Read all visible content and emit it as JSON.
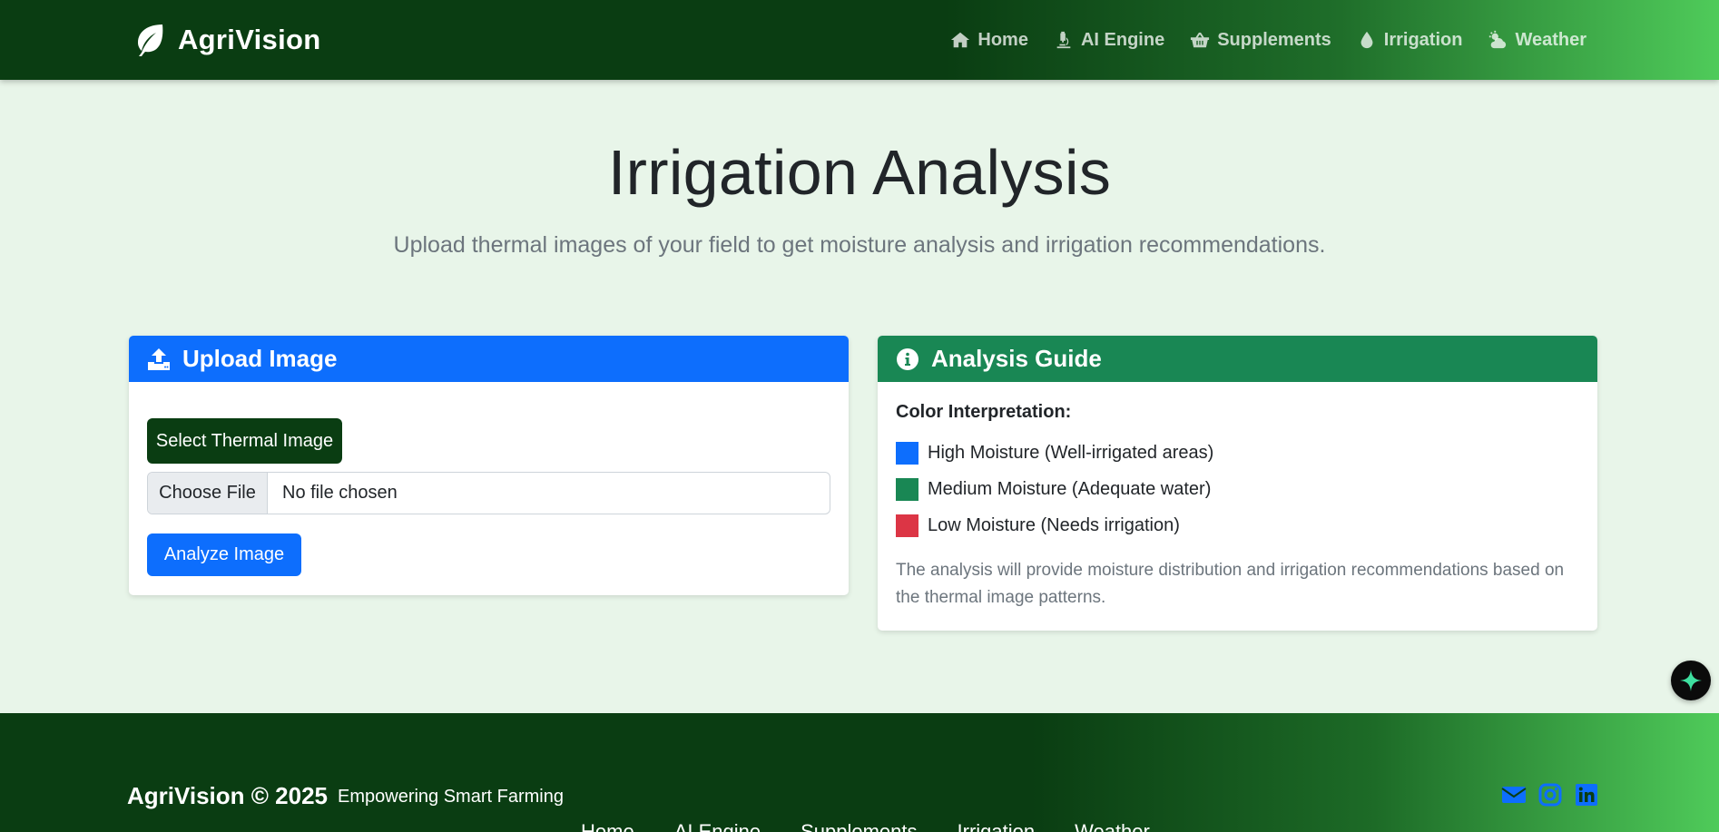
{
  "brand": {
    "name": "AgriVision"
  },
  "nav": {
    "items": [
      {
        "label": "Home",
        "icon": "home-icon"
      },
      {
        "label": "AI Engine",
        "icon": "microscope-icon"
      },
      {
        "label": "Supplements",
        "icon": "basket-icon"
      },
      {
        "label": "Irrigation",
        "icon": "water-drop-icon"
      },
      {
        "label": "Weather",
        "icon": "cloud-sun-icon"
      }
    ]
  },
  "hero": {
    "title": "Irrigation Analysis",
    "subtitle": "Upload thermal images of your field to get moisture analysis and irrigation recommendations."
  },
  "upload": {
    "header": "Upload Image",
    "select_label": "Select Thermal Image",
    "choose_file_label": "Choose File",
    "file_status": "No file chosen",
    "analyze_label": "Analyze Image"
  },
  "guide": {
    "header": "Analysis Guide",
    "label": "Color Interpretation:",
    "legend": [
      {
        "label": "High Moisture (Well-irrigated areas)",
        "color": "#0d6efd"
      },
      {
        "label": "Medium Moisture (Adequate water)",
        "color": "#198754"
      },
      {
        "label": "Low Moisture (Needs irrigation)",
        "color": "#dc3545"
      }
    ],
    "note": "The analysis will provide moisture distribution and irrigation recommendations based on the thermal image patterns."
  },
  "footer": {
    "brand": "AgriVision © 2025",
    "tagline": "Empowering Smart Farming",
    "links": [
      "Home",
      "AI Engine",
      "Supplements",
      "Irrigation",
      "Weather"
    ],
    "social": [
      "envelope-icon",
      "instagram-icon",
      "linkedin-icon"
    ]
  },
  "colors": {
    "nav_dark": "#0a3d12",
    "nav_light": "#4fcb5a",
    "primary": "#0d6efd",
    "success": "#198754",
    "danger": "#dc3545",
    "page_bg": "#e8f5e9"
  }
}
